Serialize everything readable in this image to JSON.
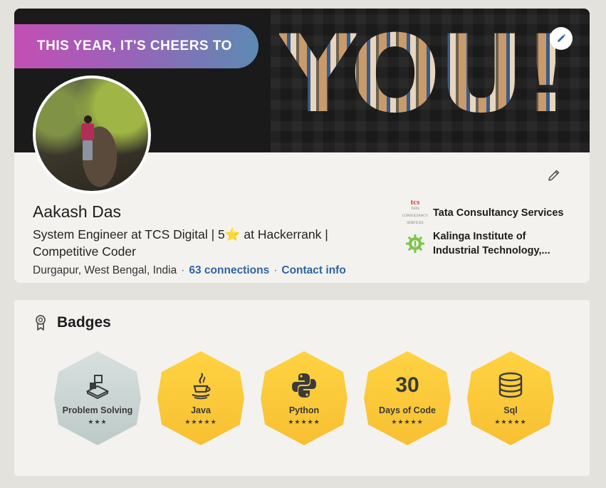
{
  "banner": {
    "tagline": "THIS YEAR, IT'S CHEERS TO",
    "highlight": "YOU!"
  },
  "profile": {
    "name": "Aakash Das",
    "headline": "System Engineer at TCS Digital | 5⭐ at Hackerrank | Competitive Coder",
    "location": "Durgapur, West Bengal, India",
    "connections": "63 connections",
    "contact_info": "Contact info",
    "separator": "·",
    "organizations": [
      {
        "name": "Tata Consultancy Services",
        "logo_text": "tcs",
        "logo_subtext": "TATA CONSULTANCY SERVICES"
      },
      {
        "name": "Kalinga Institute of Industrial Technology,..."
      }
    ]
  },
  "badges": {
    "title": "Badges",
    "items": [
      {
        "label": "Problem Solving",
        "stars": "★★★",
        "icon": "cube-blocks-icon",
        "tier": "silver"
      },
      {
        "label": "Java",
        "stars": "★★★★★",
        "icon": "java-cup-icon",
        "tier": "gold"
      },
      {
        "label": "Python",
        "stars": "★★★★★",
        "icon": "python-logo-icon",
        "tier": "gold"
      },
      {
        "label": "Days of Code",
        "stars": "★★★★★",
        "number": "30",
        "tier": "gold"
      },
      {
        "label": "Sql",
        "stars": "★★★★★",
        "icon": "database-icon",
        "tier": "gold"
      }
    ]
  },
  "colors": {
    "link": "#2f64a3",
    "gold_badge": "#f7c032",
    "silver_badge": "#c5d0ce",
    "card_bg": "#f3f2ef",
    "page_bg": "#e4e2dd"
  }
}
